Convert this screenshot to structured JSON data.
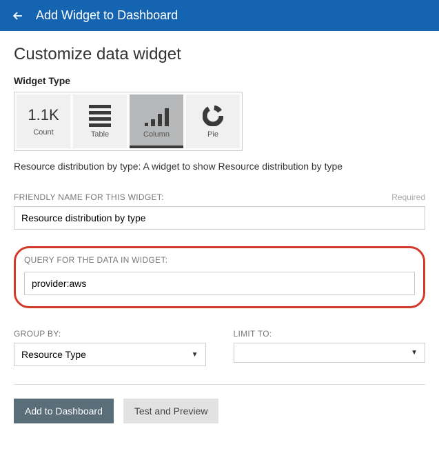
{
  "header": {
    "title": "Add Widget to Dashboard"
  },
  "page": {
    "title": "Customize data widget"
  },
  "widgetType": {
    "label": "Widget Type",
    "options": [
      {
        "big": "1.1K",
        "label": "Count"
      },
      {
        "label": "Table"
      },
      {
        "label": "Column"
      },
      {
        "label": "Pie"
      }
    ]
  },
  "description": "Resource distribution by type: A widget to show Resource distribution by type",
  "friendlyName": {
    "label": "FRIENDLY NAME FOR THIS WIDGET:",
    "required": "Required",
    "value": "Resource distribution by type"
  },
  "query": {
    "label": "QUERY FOR THE DATA IN WIDGET:",
    "value": "provider:aws"
  },
  "groupBy": {
    "label": "GROUP BY:",
    "value": "Resource Type"
  },
  "limitTo": {
    "label": "LIMIT TO:",
    "value": ""
  },
  "actions": {
    "primary": "Add to Dashboard",
    "secondary": "Test and Preview"
  }
}
